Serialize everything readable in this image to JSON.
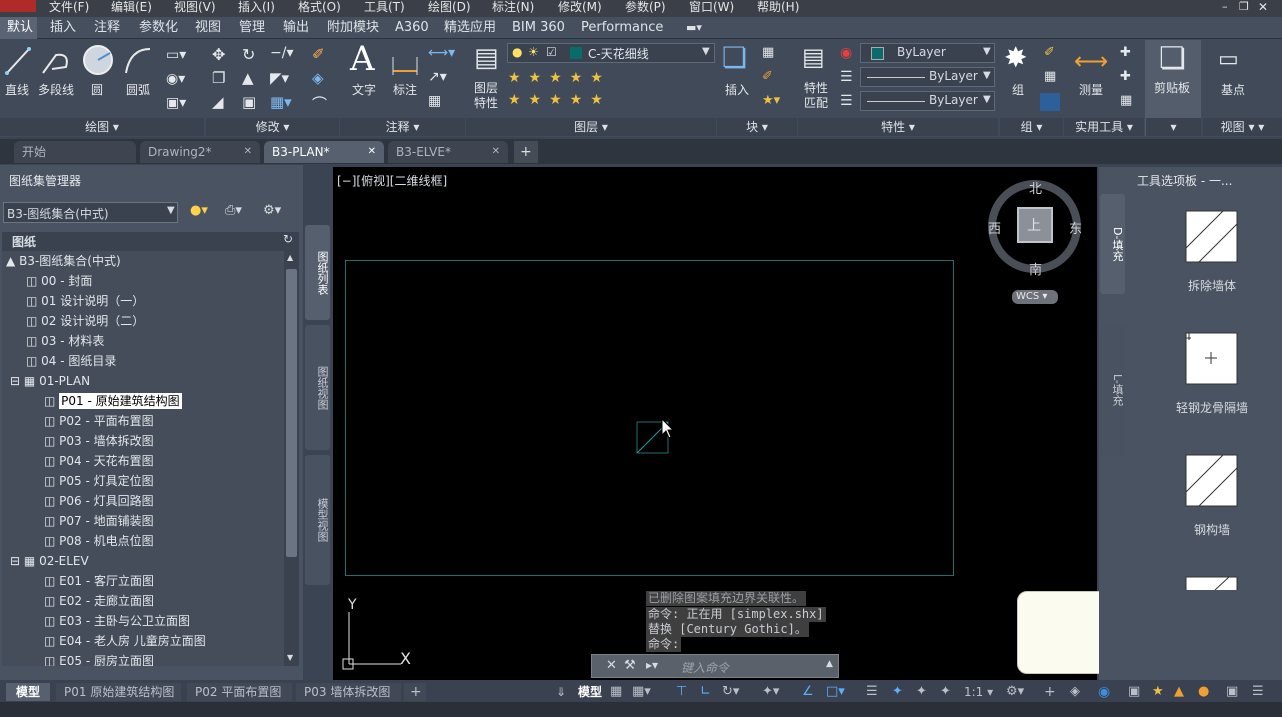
{
  "menu": [
    "文件(F)",
    "编辑(E)",
    "视图(V)",
    "插入(I)",
    "格式(O)",
    "工具(T)",
    "绘图(D)",
    "标注(N)",
    "修改(M)",
    "参数(P)",
    "窗口(W)",
    "帮助(H)"
  ],
  "ribbon_tabs": [
    "默认",
    "插入",
    "注释",
    "参数化",
    "视图",
    "管理",
    "输出",
    "附加模块",
    "A360",
    "精选应用",
    "BIM 360",
    "Performance"
  ],
  "ribbon": {
    "draw": {
      "line": "直线",
      "pline": "多段线",
      "circle": "圆",
      "arc": "圆弧",
      "title": "绘图"
    },
    "modify_title": "修改",
    "annot": {
      "text": "文字",
      "dim": "标注",
      "title": "注释"
    },
    "layer": {
      "props": "图层\n特性",
      "layer_name": "C-天花细线",
      "title": "图层"
    },
    "block": {
      "insert": "插入",
      "title": "块"
    },
    "props": {
      "match": "特性\n匹配",
      "color": "ByLayer",
      "linetype": "ByLayer",
      "lineweight": "ByLayer",
      "title": "特性"
    },
    "group": {
      "group": "组",
      "title": "组"
    },
    "util": {
      "measure": "测量",
      "title": "实用工具"
    },
    "clip": {
      "paste": "剪贴板"
    },
    "view": {
      "base": "基点",
      "title": "视图"
    }
  },
  "doc_tabs": [
    "开始",
    "Drawing2*",
    "B3-PLAN*",
    "B3-ELVE*"
  ],
  "sheetset": {
    "title": "图纸集管理器",
    "combo": "B3-图纸集合(中式)",
    "section": "图纸",
    "root": "B3-图纸集合(中式)",
    "sheets": [
      "00 - 封面",
      "01 设计说明（一）",
      "02 设计说明（二）",
      "03 - 材料表",
      "04 - 图纸目录"
    ],
    "plan_group": "01-PLAN",
    "plan": [
      "P01 - 原始建筑结构图",
      "P02 - 平面布置图",
      "P03 - 墙体拆改图",
      "P04 - 天花布置图",
      "P05 - 灯具定位图",
      "P06 - 灯具回路图",
      "P07 - 地面铺装图",
      "P08 - 机电点位图"
    ],
    "elev_group": "02-ELEV",
    "elev": [
      "E01 - 客厅立面图",
      "E02 - 走廊立面图",
      "E03 - 主卧与公卫立面图",
      "E04 - 老人房 儿童房立面图",
      "E05 - 厨房立面图"
    ],
    "side_tabs": [
      "图纸列表",
      "图纸视图",
      "模型视图"
    ]
  },
  "viewport": {
    "label": "[−][俯视][二维线框]",
    "cube": {
      "n": "北",
      "s": "南",
      "e": "东",
      "w": "西",
      "top": "上",
      "wcs": "WCS"
    },
    "ucs_x": "X",
    "ucs_y": "Y"
  },
  "cmd": {
    "history": [
      "已删除图案填充边界关联性。",
      "命令: 正在用 [simplex.shx]",
      "替换 [Century Gothic]。",
      "命令:"
    ],
    "placeholder": "键入命令"
  },
  "tool_palette": {
    "title": "工具选项板 - 一...",
    "side_tabs": [
      "D-填充",
      "L-填充"
    ],
    "items": [
      "拆除墙体",
      "轻钢龙骨隔墙",
      "钢构墙"
    ]
  },
  "layout_tabs": [
    "模型",
    "P01 原始建筑结构图",
    "P02 平面布置图",
    "P03 墙体拆改图"
  ],
  "status": {
    "model": "模型",
    "scale": "1:1"
  },
  "colors": {
    "layer_swatch": "#0b6b6b",
    "viewport_border": "#1f6f6f"
  }
}
